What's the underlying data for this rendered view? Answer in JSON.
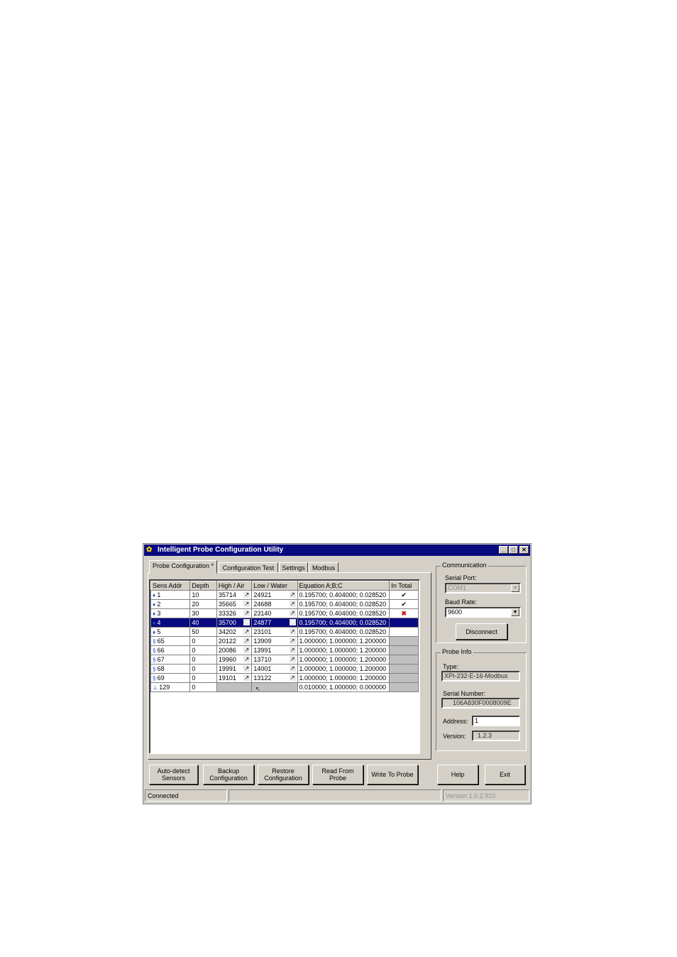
{
  "window": {
    "title": "Intelligent Probe Configuration Utility"
  },
  "tabs": [
    "Probe Configuration *",
    "Configuration Test",
    "Settings",
    "Modbus"
  ],
  "grid": {
    "columns": [
      "Sens Addr",
      "Depth",
      "High / Air",
      "Low / Water",
      "Equation A;B;C",
      "In Total"
    ],
    "rows": [
      {
        "icon": "drop-icon",
        "addr": "1",
        "depth": "10",
        "high": "35714",
        "low": "24921",
        "eq": "0.195700; 0.404000; 0.028520",
        "total": "✔"
      },
      {
        "icon": "drop-icon",
        "addr": "2",
        "depth": "20",
        "high": "35665",
        "low": "24688",
        "eq": "0.195700; 0.404000; 0.028520",
        "total": "✔"
      },
      {
        "icon": "drop-icon",
        "addr": "3",
        "depth": "30",
        "high": "33326",
        "low": "23140",
        "eq": "0.195700; 0.404000; 0.028520",
        "total": "✖"
      },
      {
        "icon": "drop-icon",
        "addr": "4",
        "depth": "40",
        "high": "35700",
        "low": "24877",
        "eq": "0.195700; 0.404000; 0.028520",
        "total": "",
        "selected": true
      },
      {
        "icon": "drop-icon",
        "addr": "5",
        "depth": "50",
        "high": "34202",
        "low": "23101",
        "eq": "0.195700; 0.404000; 0.028520",
        "total": ""
      },
      {
        "icon": "coil-icon",
        "addr": "65",
        "depth": "0",
        "high": "20122",
        "low": "13909",
        "eq": "1.000000; 1.000000; 1.200000",
        "total": "",
        "gray": true
      },
      {
        "icon": "coil-icon",
        "addr": "66",
        "depth": "0",
        "high": "20086",
        "low": "13991",
        "eq": "1.000000; 1.000000; 1.200000",
        "total": "",
        "gray": true
      },
      {
        "icon": "coil-icon",
        "addr": "67",
        "depth": "0",
        "high": "19960",
        "low": "13710",
        "eq": "1.000000; 1.000000; 1.200000",
        "total": "",
        "gray": true
      },
      {
        "icon": "coil-icon",
        "addr": "68",
        "depth": "0",
        "high": "19991",
        "low": "14001",
        "eq": "1.000000; 1.000000; 1.200000",
        "total": "",
        "gray": true
      },
      {
        "icon": "coil-icon",
        "addr": "69",
        "depth": "0",
        "high": "19101",
        "low": "13122",
        "eq": "1.000000; 1.000000; 1.200000",
        "total": "",
        "gray": true
      },
      {
        "icon": "thermometer-icon",
        "addr": "129",
        "depth": "0",
        "high": "",
        "low": "",
        "eq": "0.010000; 1.000000; 0.000000",
        "total": "",
        "gray": true,
        "nocal": true
      }
    ]
  },
  "communication": {
    "title": "Communication",
    "serial_port_label": "Serial Port:",
    "serial_port_value": "COM1",
    "baud_rate_label": "Baud Rate:",
    "baud_rate_value": "9600",
    "disconnect_label": "Disconnect"
  },
  "probe_info": {
    "title": "Probe Info",
    "type_label": "Type:",
    "type_value": "XPI-232-E-16-Modbus",
    "serial_label": "Serial Number:",
    "serial_value": "106A830F0008009E",
    "address_label": "Address:",
    "address_value": "1",
    "version_label": "Version:",
    "version_value": "1.2.3"
  },
  "buttons": {
    "autodetect": [
      "Auto-detect",
      "Sensors"
    ],
    "backup": [
      "Backup",
      "Configuration"
    ],
    "restore": [
      "Restore",
      "Configuration"
    ],
    "read": [
      "Read From",
      "Probe"
    ],
    "write": "Write To Probe",
    "help": "Help",
    "exit": "Exit"
  },
  "status": {
    "left": "Connected",
    "right": "Version 1.0.2.910"
  }
}
